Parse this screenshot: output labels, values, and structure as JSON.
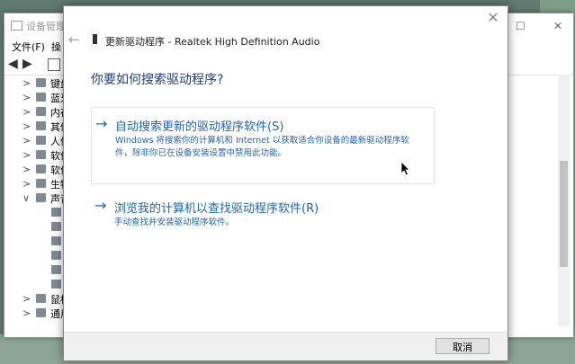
{
  "device_manager": {
    "title": "设备管理器",
    "menu": [
      "文件(F)",
      "操"
    ],
    "toolbar": {
      "back_icon": "arrow-left-icon",
      "forward_icon": "arrow-right-icon"
    },
    "window_controls": {
      "maximize": "☐",
      "close": "✕"
    },
    "tree": [
      {
        "chevron": ">",
        "label": "键盘",
        "icon": "keyboard-icon"
      },
      {
        "chevron": ">",
        "label": "蓝牙",
        "icon": "bluetooth-icon"
      },
      {
        "chevron": ">",
        "label": "内存",
        "icon": "memory-icon"
      },
      {
        "chevron": ">",
        "label": "其他",
        "icon": "other-devices-icon"
      },
      {
        "chevron": ">",
        "label": "人体",
        "icon": "hid-icon"
      },
      {
        "chevron": ">",
        "label": "软件",
        "icon": "software-icon"
      },
      {
        "chevron": ">",
        "label": "软件",
        "icon": "software-component-icon"
      },
      {
        "chevron": ">",
        "label": "生物",
        "icon": "biometric-icon"
      },
      {
        "chevron": "∨",
        "label": "声音",
        "icon": "speaker-icon"
      },
      {
        "chevron": "",
        "label": "",
        "icon": "audio-device-icon"
      },
      {
        "chevron": "",
        "label": "",
        "icon": "audio-device-icon"
      },
      {
        "chevron": "",
        "label": "",
        "icon": "audio-device-icon"
      },
      {
        "chevron": "",
        "label": "",
        "icon": "audio-device-icon"
      },
      {
        "chevron": "",
        "label": "",
        "icon": "audio-device-icon"
      },
      {
        "chevron": "",
        "label": "",
        "icon": "audio-device-icon"
      },
      {
        "chevron": ">",
        "label": "鼠标",
        "icon": "mouse-icon"
      },
      {
        "chevron": ">",
        "label": "通用",
        "icon": "usb-icon"
      }
    ]
  },
  "dialog": {
    "title": "更新驱动程序 - Realtek High Definition Audio",
    "heading": "你要如何搜索驱动程序?",
    "options": [
      {
        "arrow": "→",
        "title": "自动搜索更新的驱动程序软件(S)",
        "description": "Windows 将搜索你的计算机和 Internet 以获取适合你设备的最新驱动程序软件，除非你已在设备安装设置中禁用此功能。"
      },
      {
        "arrow": "→",
        "title": "浏览我的计算机以查找驱动程序软件(R)",
        "description": "手动查找并安装驱动程序软件。"
      }
    ],
    "close_glyph": "✕",
    "back_glyph": "←",
    "cancel_label": "取消"
  },
  "colors": {
    "link_blue": "#1d64c6",
    "heading_blue": "#1e3c8c",
    "desktop": "#5f7a70"
  }
}
